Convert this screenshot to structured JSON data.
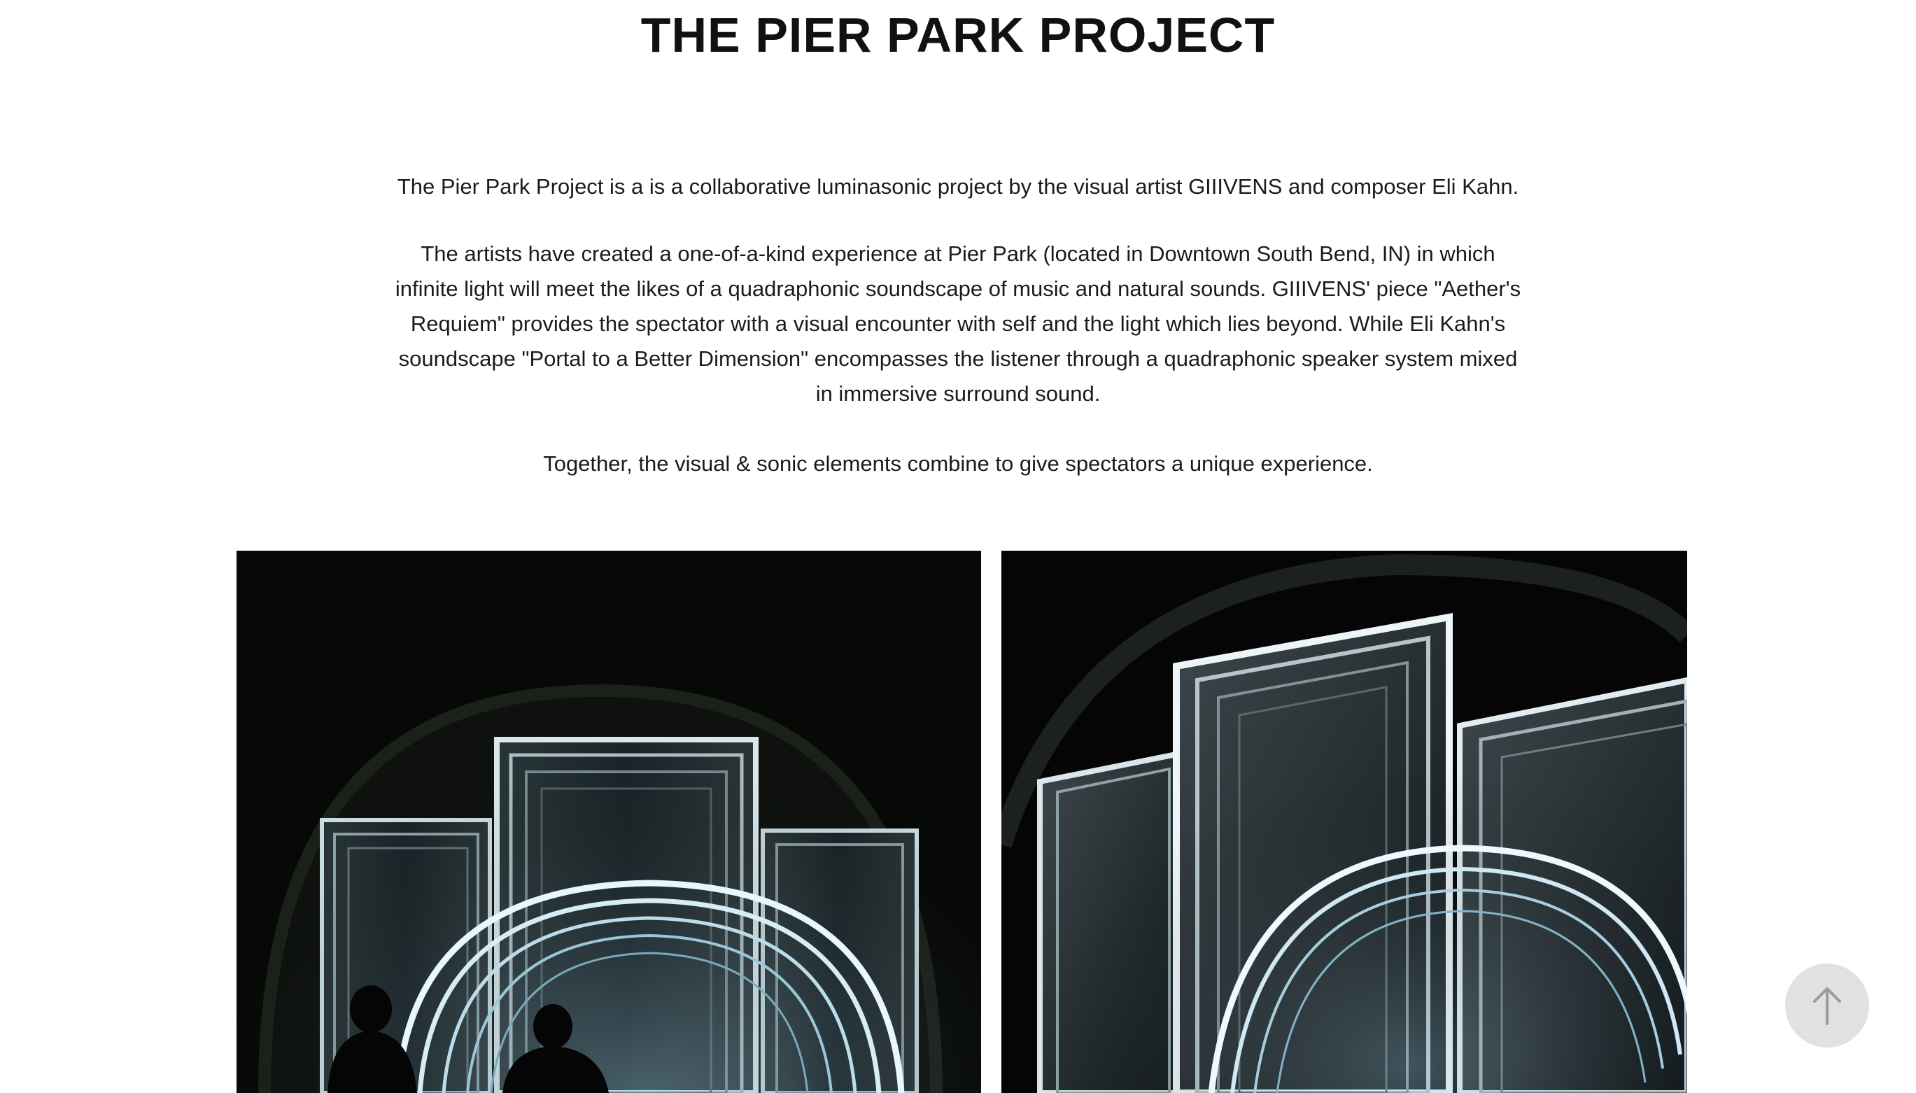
{
  "page": {
    "title": "THE PIER PARK PROJECT"
  },
  "content": {
    "intro": "The Pier Park Project is a  is a collaborative luminasonic project by the visual artist GIIIVENS and composer Eli Kahn.",
    "description": "The artists have created a one-of-a-kind experience at Pier Park (located in Downtown South Bend, IN) in which infinite light will meet the likes of a quadraphonic soundscape of music and natural sounds. GIIIVENS' piece \"Aether's Requiem\" provides the spectator with a visual encounter with self and the light which lies beyond.  While Eli Kahn's soundscape \"Portal to a Better Dimension\" encompasses the listener through a quadraphonic speaker system mixed in immersive surround sound.",
    "closing": "Together, the visual & sonic elements combine to give spectators a unique experience."
  },
  "gallery": {
    "images": [
      {
        "subject": "light-installation-with-spectators"
      },
      {
        "subject": "light-installation-mirror-frames"
      }
    ]
  },
  "controls": {
    "scroll_top_icon": "arrow-up-icon"
  },
  "colors": {
    "text": "#1b1b1b",
    "title": "#111111",
    "scroll_button_bg": "#e1e1e1",
    "scroll_arrow": "#9a9a9a",
    "neon": "#e8f6ff"
  }
}
